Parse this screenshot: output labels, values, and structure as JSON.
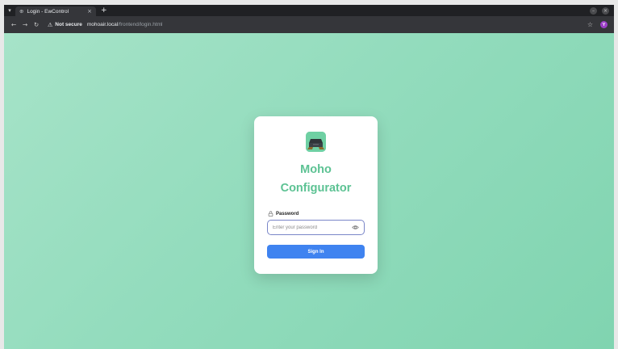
{
  "browser": {
    "tab_title": "Login - EwControl",
    "tab_close": "×",
    "new_tab": "+",
    "security_label": "Not secure",
    "url_host": "mohoair.local",
    "url_path": "/frontend/login.html",
    "profile_initial": "Y",
    "colors": {
      "chrome": "#202124",
      "toolbar": "#35363a",
      "profile": "#9c3fc7"
    }
  },
  "login": {
    "brand_line1": "Moho",
    "brand_line2": "Configurator",
    "password_label": "Password",
    "password_placeholder": "Enter your password",
    "password_value": "",
    "sign_in_label": "Sign In",
    "colors": {
      "brand": "#5cc293",
      "button": "#3f83f0",
      "field_border": "#7a86c8"
    },
    "icons": [
      "lock-icon",
      "eye-icon",
      "app-logo-icon"
    ]
  }
}
